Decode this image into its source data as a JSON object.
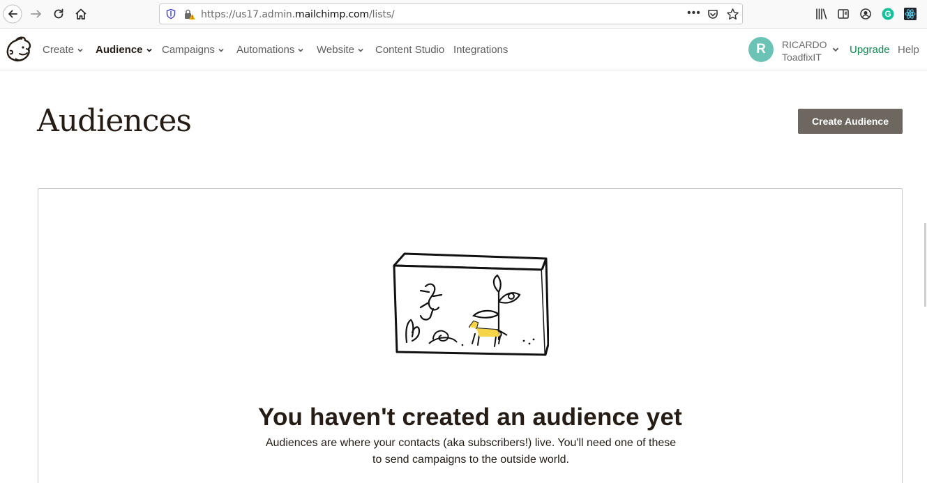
{
  "browser": {
    "url_prefix": "https://us17.admin.",
    "url_domain": "mailchimp.com",
    "url_path": "/lists/",
    "more_label": "•••"
  },
  "nav": {
    "items": [
      {
        "label": "Create",
        "dropdown": true,
        "active": false
      },
      {
        "label": "Audience",
        "dropdown": true,
        "active": true
      },
      {
        "label": "Campaigns",
        "dropdown": true,
        "active": false
      },
      {
        "label": "Automations",
        "dropdown": true,
        "active": false
      },
      {
        "label": "Website",
        "dropdown": true,
        "active": false
      },
      {
        "label": "Content Studio",
        "dropdown": false,
        "active": false
      },
      {
        "label": "Integrations",
        "dropdown": false,
        "active": false
      }
    ],
    "account": {
      "avatar_initial": "R",
      "name": "RICARDO",
      "org": "ToadfixIT"
    },
    "upgrade_label": "Upgrade",
    "help_label": "Help"
  },
  "page": {
    "title": "Audiences",
    "create_button": "Create Audience"
  },
  "empty_state": {
    "title": "You haven't created an audience yet",
    "desc_line1": "Audiences are where your contacts (aka subscribers!) live. You'll need one of these",
    "desc_line2": "to send campaigns to the outside world."
  },
  "colors": {
    "avatar": "#6bc3b6",
    "create_button_bg": "#6e6760",
    "upgrade": "#0e8a4f",
    "illustration_accent": "#f5d547"
  }
}
